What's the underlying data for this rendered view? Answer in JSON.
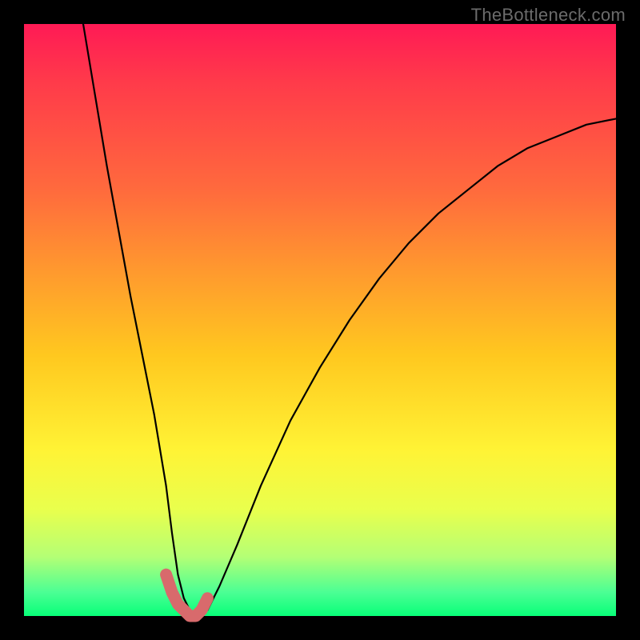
{
  "watermark": "TheBottleneck.com",
  "chart_data": {
    "type": "line",
    "title": "",
    "xlabel": "",
    "ylabel": "",
    "xlim": [
      0,
      100
    ],
    "ylim": [
      0,
      100
    ],
    "series": [
      {
        "name": "bottleneck-curve",
        "x": [
          10,
          12,
          14,
          16,
          18,
          20,
          22,
          24,
          25,
          26,
          27,
          28,
          29,
          30,
          31,
          33,
          36,
          40,
          45,
          50,
          55,
          60,
          65,
          70,
          75,
          80,
          85,
          90,
          95,
          100
        ],
        "values": [
          100,
          88,
          76,
          65,
          54,
          44,
          34,
          22,
          14,
          7,
          3,
          1,
          0,
          0,
          1,
          5,
          12,
          22,
          33,
          42,
          50,
          57,
          63,
          68,
          72,
          76,
          79,
          81,
          83,
          84
        ]
      },
      {
        "name": "highlight-segment",
        "x": [
          24,
          25,
          26,
          27,
          28,
          29,
          30,
          31
        ],
        "values": [
          7,
          4,
          2,
          1,
          0,
          0,
          1,
          3
        ]
      }
    ],
    "colors": {
      "curve": "#000000",
      "highlight": "#d86a6c"
    }
  }
}
